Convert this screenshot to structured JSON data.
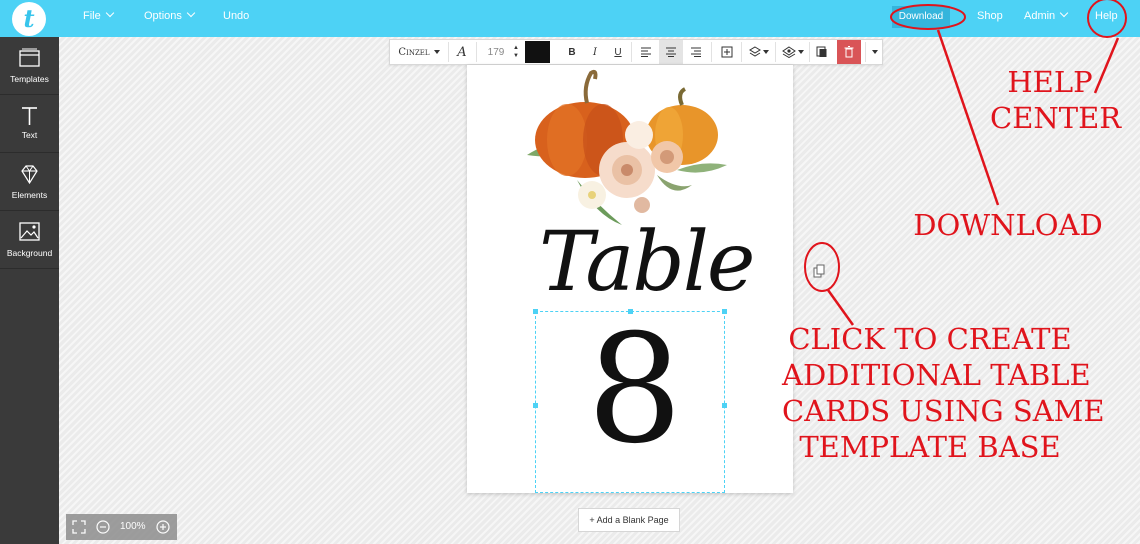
{
  "logo": "t",
  "nav": {
    "file": "File",
    "options": "Options",
    "undo": "Undo",
    "download": "Download",
    "shop": "Shop",
    "admin": "Admin",
    "help": "Help"
  },
  "sidebar": {
    "items": [
      {
        "label": "Templates",
        "icon": "templates-icon"
      },
      {
        "label": "Text",
        "icon": "text-icon"
      },
      {
        "label": "Elements",
        "icon": "diamond-icon"
      },
      {
        "label": "Background",
        "icon": "image-icon"
      }
    ]
  },
  "toolbar": {
    "font_name": "Cinzel",
    "font_size": "179",
    "color": "#111111",
    "bold": "B",
    "italic": "I",
    "underline": "U"
  },
  "page": {
    "title_word": "Table",
    "number": "8"
  },
  "add_page_label": "+ Add a Blank Page",
  "zoom_level": "100%",
  "annotations": {
    "help": [
      "HELP",
      "CENTER"
    ],
    "download": "DOWNLOAD",
    "create": [
      "CLICK TO CREATE",
      "ADDITIONAL TABLE",
      "CARDS USING SAME",
      "TEMPLATE BASE"
    ]
  },
  "colors": {
    "topbar": "#4dd2f5",
    "sidebar": "#3a3a3a",
    "annotation": "#e0141c",
    "delete_button": "#d95457"
  }
}
